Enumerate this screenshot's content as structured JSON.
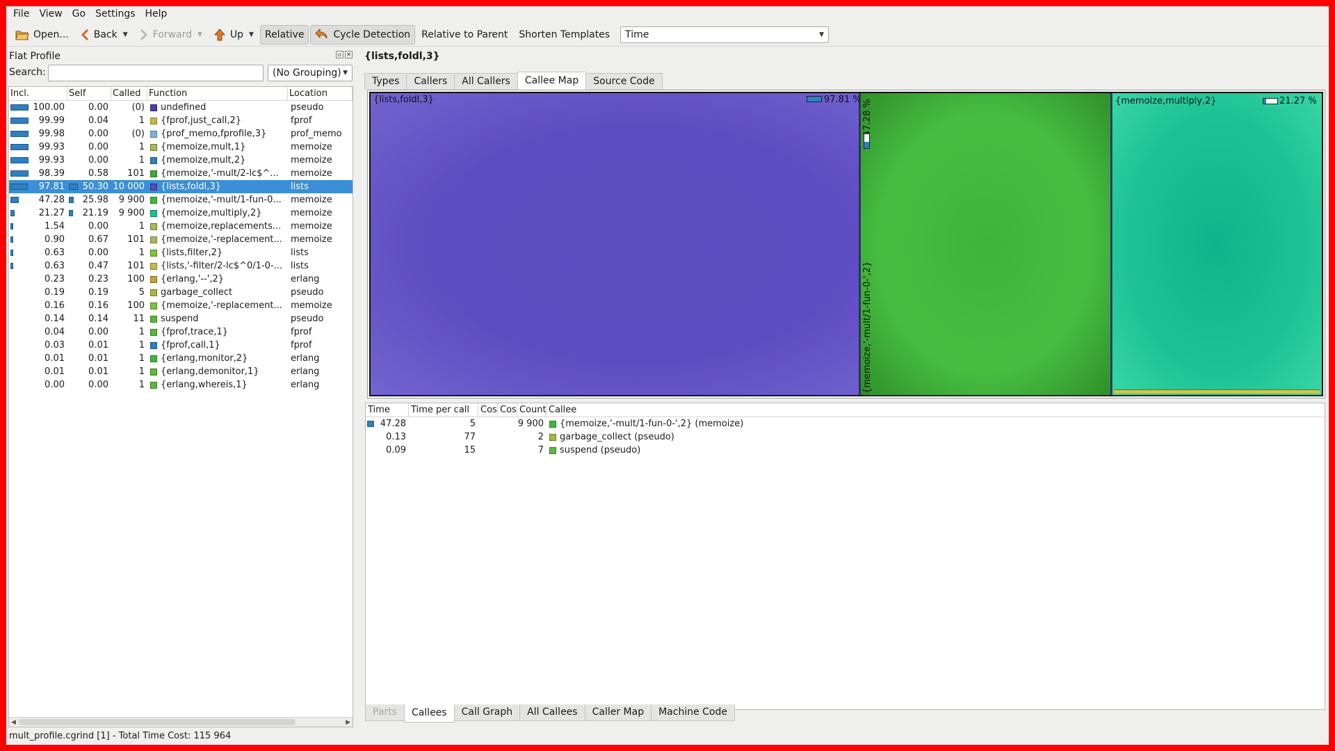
{
  "menu": [
    "File",
    "View",
    "Go",
    "Settings",
    "Help"
  ],
  "toolbar": {
    "open": "Open...",
    "back": "Back",
    "forward": "Forward",
    "up": "Up",
    "relative": "Relative",
    "cycle": "Cycle Detection",
    "relative_parent": "Relative to Parent",
    "shorten": "Shorten Templates",
    "event_type": "Time"
  },
  "flat_profile": {
    "title": "Flat Profile",
    "search_label": "Search:",
    "search_value": "",
    "grouping": "(No Grouping)",
    "columns": [
      "Incl.",
      "Self",
      "Called",
      "Function",
      "Location"
    ],
    "rows": [
      {
        "incl": "100.00",
        "self": "0.00",
        "called": "(0)",
        "func": "undefined",
        "loc": "pseudo",
        "color": "#4b3fb0",
        "incl_pct": 100,
        "self_pct": 0
      },
      {
        "incl": "99.99",
        "self": "0.04",
        "called": "1",
        "func": "{fprof,just_call,2}",
        "loc": "fprof",
        "color": "#c8b84a",
        "incl_pct": 99.99,
        "self_pct": 0
      },
      {
        "incl": "99.98",
        "self": "0.00",
        "called": "(0)",
        "func": "{prof_memo,fprofile,3}",
        "loc": "prof_memo",
        "color": "#7fb5d0",
        "incl_pct": 99.98,
        "self_pct": 0
      },
      {
        "incl": "99.93",
        "self": "0.00",
        "called": "1",
        "func": "{memoize,mult,1}",
        "loc": "memoize",
        "color": "#a8b85a",
        "incl_pct": 99.93,
        "self_pct": 0
      },
      {
        "incl": "99.93",
        "self": "0.00",
        "called": "1",
        "func": "{memoize,mult,2}",
        "loc": "memoize",
        "color": "#2f7fc1",
        "incl_pct": 99.93,
        "self_pct": 0
      },
      {
        "incl": "98.39",
        "self": "0.58",
        "called": "101",
        "func": "{memoize,'-mult/2-lc$^...",
        "loc": "memoize",
        "color": "#3fa83a",
        "incl_pct": 98.39,
        "self_pct": 0
      },
      {
        "incl": "97.81",
        "self": "50.30",
        "called": "10 000",
        "func": "{lists,foldl,3}",
        "loc": "lists",
        "color": "#5a4ac0",
        "incl_pct": 97.81,
        "self_pct": 50.3,
        "selected": true
      },
      {
        "incl": "47.28",
        "self": "25.98",
        "called": "9 900",
        "func": "{memoize,'-mult/1-fun-0...",
        "loc": "memoize",
        "color": "#3fb83a",
        "incl_pct": 47.28,
        "self_pct": 25.98
      },
      {
        "incl": "21.27",
        "self": "21.19",
        "called": "9 900",
        "func": "{memoize,multiply,2}",
        "loc": "memoize",
        "color": "#1dbf94",
        "incl_pct": 21.27,
        "self_pct": 21.19
      },
      {
        "incl": "1.54",
        "self": "0.00",
        "called": "1",
        "func": "{memoize,replacements...",
        "loc": "memoize",
        "color": "#a8b85a",
        "incl_pct": 1.54,
        "self_pct": 0
      },
      {
        "incl": "0.90",
        "self": "0.67",
        "called": "101",
        "func": "{memoize,'-replacement...",
        "loc": "memoize",
        "color": "#a8b85a",
        "incl_pct": 0.9,
        "self_pct": 0.67
      },
      {
        "incl": "0.63",
        "self": "0.00",
        "called": "1",
        "func": "{lists,filter,2}",
        "loc": "lists",
        "color": "#7cc23c",
        "incl_pct": 0.63,
        "self_pct": 0
      },
      {
        "incl": "0.63",
        "self": "0.47",
        "called": "101",
        "func": "{lists,'-filter/2-lc$^0/1-0-...",
        "loc": "lists",
        "color": "#c8b84a",
        "incl_pct": 0.63,
        "self_pct": 0.47
      },
      {
        "incl": "0.23",
        "self": "0.23",
        "called": "100",
        "func": "{erlang,'--',2}",
        "loc": "erlang",
        "color": "#c8a03a",
        "incl_pct": 0.23,
        "self_pct": 0.23
      },
      {
        "incl": "0.19",
        "self": "0.19",
        "called": "5",
        "func": "garbage_collect",
        "loc": "pseudo",
        "color": "#a8b83a",
        "incl_pct": 0.19,
        "self_pct": 0.19
      },
      {
        "incl": "0.16",
        "self": "0.16",
        "called": "100",
        "func": "{memoize,'-replacement...",
        "loc": "memoize",
        "color": "#7cc23c",
        "incl_pct": 0.16,
        "self_pct": 0.16
      },
      {
        "incl": "0.14",
        "self": "0.14",
        "called": "11",
        "func": "suspend",
        "loc": "pseudo",
        "color": "#5cb83a",
        "incl_pct": 0.14,
        "self_pct": 0.14
      },
      {
        "incl": "0.04",
        "self": "0.00",
        "called": "1",
        "func": "{fprof,trace,1}",
        "loc": "fprof",
        "color": "#5cb83a",
        "incl_pct": 0.04,
        "self_pct": 0
      },
      {
        "incl": "0.03",
        "self": "0.01",
        "called": "1",
        "func": "{fprof,call,1}",
        "loc": "fprof",
        "color": "#2f7fc1",
        "incl_pct": 0.03,
        "self_pct": 0.01
      },
      {
        "incl": "0.01",
        "self": "0.01",
        "called": "1",
        "func": "{erlang,monitor,2}",
        "loc": "erlang",
        "color": "#3fb83a",
        "incl_pct": 0.01,
        "self_pct": 0.01
      },
      {
        "incl": "0.01",
        "self": "0.01",
        "called": "1",
        "func": "{erlang,demonitor,1}",
        "loc": "erlang",
        "color": "#5cb83a",
        "incl_pct": 0.01,
        "self_pct": 0.01
      },
      {
        "incl": "0.00",
        "self": "0.00",
        "called": "1",
        "func": "{erlang,whereis,1}",
        "loc": "erlang",
        "color": "#5cb83a",
        "incl_pct": 0,
        "self_pct": 0
      }
    ]
  },
  "status": "mult_profile.cgrind [1] - Total Time Cost: 115 964",
  "detail": {
    "function_title": "{lists,foldl,3}",
    "top_tabs": [
      {
        "label": "Types",
        "active": false
      },
      {
        "label": "Callers",
        "active": false
      },
      {
        "label": "All Callers",
        "active": false
      },
      {
        "label": "Callee Map",
        "active": true
      },
      {
        "label": "Source Code",
        "active": false
      }
    ],
    "treemap": {
      "main_label": "{lists,foldl,3}",
      "main_pct": "97.81 %",
      "main_pct_value": 97.81,
      "child1_label": "{memoize,'-mult/1-fun-0-',2}",
      "child1_pct": "47.28 %",
      "child1_pct_value": 47.28,
      "child2_label": "{memoize,multiply,2}",
      "child2_pct": "21.27 %",
      "child2_pct_value": 21.27
    },
    "callees": {
      "columns": [
        "Time",
        "Time per call",
        "Cos",
        "Cos",
        "Count",
        "Callee"
      ],
      "rows": [
        {
          "time": "47.28",
          "tpc": "5",
          "count": "9 900",
          "callee": "{memoize,'-mult/1-fun-0-',2} (memoize)",
          "color": "#3fb83a",
          "time_pct": 47.28
        },
        {
          "time": "0.13",
          "tpc": "77",
          "count": "2",
          "callee": "garbage_collect (pseudo)",
          "color": "#a8b83a",
          "time_pct": 0.13
        },
        {
          "time": "0.09",
          "tpc": "15",
          "count": "7",
          "callee": "suspend (pseudo)",
          "color": "#5cb83a",
          "time_pct": 0.09
        }
      ]
    },
    "bottom_tabs": [
      {
        "label": "Parts",
        "active": false,
        "disabled": true
      },
      {
        "label": "Callees",
        "active": true
      },
      {
        "label": "Call Graph",
        "active": false
      },
      {
        "label": "All Callees",
        "active": false
      },
      {
        "label": "Caller Map",
        "active": false
      },
      {
        "label": "Machine Code",
        "active": false
      }
    ]
  }
}
